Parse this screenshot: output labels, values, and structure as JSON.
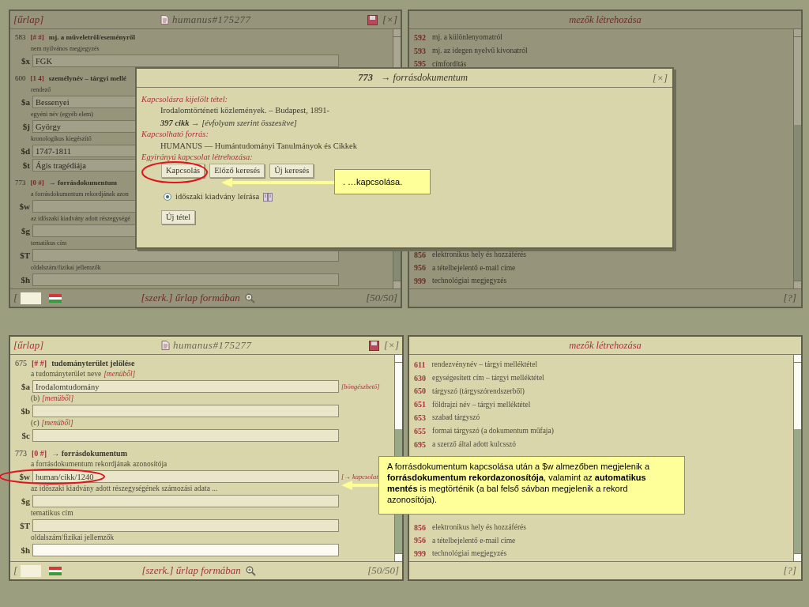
{
  "top_form_window": {
    "dimmed": true,
    "header_left": "[űrlap]",
    "title": "humanus#175277",
    "header_right": "[×]",
    "tags": [
      {
        "tag": "583",
        "indicators": "[# #]",
        "name": "mj. a műveletről/eseményről",
        "subfields": [
          {
            "hint": "nem nyilvános megjegyzés",
            "code": "$x",
            "value": "FGK"
          }
        ]
      },
      {
        "tag": "600",
        "indicators": "[1 4]",
        "name": "személynév – tárgyi mellé",
        "subfields": [
          {
            "hint": "rendező",
            "code": "$a",
            "value": "Bessenyei"
          },
          {
            "hint": "egyéni név (egyéb elem)",
            "code": "$j",
            "value": "György"
          },
          {
            "hint": "kronologikus kiegészítő",
            "code": "$d",
            "value": "1747-1811"
          },
          {
            "code": "$t",
            "value": "Ágis tragédiája"
          }
        ]
      },
      {
        "tag": "773",
        "indicators": "[0 #]",
        "name": "→ forrásdokumentum",
        "subfields": [
          {
            "hint": "a forrásdokumentum rekordjának azon",
            "code": "$w"
          },
          {
            "hint": "az időszaki kiadvány adott részegységé",
            "code": "$g"
          },
          {
            "hint": "tematikus cím",
            "code": "$T"
          },
          {
            "hint": "oldalszám/fizikai jellemzők",
            "code": "$h"
          }
        ]
      }
    ],
    "footer_left": "[",
    "footer_center": "[szerk.] űrlap formában",
    "footer_right": "[50/50]"
  },
  "top_fields_window": {
    "dimmed": true,
    "title": "mezők létrehozása",
    "items": [
      {
        "code": "592",
        "label": "mj. a különlenyomatról"
      },
      {
        "code": "593",
        "label": "mj. az idegen nyelvű kivonatról"
      },
      {
        "code": "595",
        "label": "címfordítás"
      }
    ],
    "items_below": [
      {
        "code": "856",
        "label": "elektronikus hely és hozzáférés"
      },
      {
        "code": "956",
        "label": "a tételbejelentő e-mail címe"
      },
      {
        "code": "999",
        "label": "technológiai megjegyzés"
      }
    ],
    "footer_right": "[?]"
  },
  "dialog": {
    "tag": "773",
    "title": "→ forrásdokumentum",
    "close": "[×]",
    "sections": [
      {
        "label": "Kapcsolásra kijelölt tétel:",
        "lines": [
          "Irodalomtörténeti közlemények. – Budapest, 1891-",
          "**397 cikk** → [évfolyam szerint összesítve]"
        ]
      },
      {
        "label": "Kapcsolható forrás:",
        "lines": [
          "HUMANUS — Humántudományi Tanulmányok és Cikkek"
        ]
      },
      {
        "label": "Egyirányú kapcsolat létrehozása:"
      }
    ],
    "buttons": [
      "Kapcsolás",
      "Előző keresés",
      "Új keresés"
    ],
    "options": [
      {
        "label": "időszaki kiadvány leírása",
        "selected": true
      }
    ],
    "new_button": "Új tétel"
  },
  "callout_top": {
    "text": ". …kapcsolása."
  },
  "bottom_form_window": {
    "dimmed": false,
    "header_left": "[űrlap]",
    "title": "humanus#175277",
    "header_right": "[×]",
    "tags": [
      {
        "tag": "675",
        "indicators": "[# #]",
        "name": "tudományterület jelölése",
        "subfields": [
          {
            "hint": "a tudományterület neve",
            "hint_note": "[menüből]",
            "code": "$a",
            "value": "Irodalomtudomány",
            "side_note": "[böngészhető]"
          },
          {
            "hint": "(b)",
            "hint_note": "[menüből]",
            "code": "$b"
          },
          {
            "hint": "(c)",
            "hint_note": "[menüből]",
            "code": "$c"
          }
        ]
      },
      {
        "tag": "773",
        "indicators": "[0 #]",
        "name": "→ forrásdokumentum",
        "subfields": [
          {
            "hint": "a forrásdokumentum rekordjának azonosítója",
            "code": "$w",
            "value": "human/cikk/1240",
            "side_note": "[→ kapcsolat"
          },
          {
            "hint": "az időszaki kiadvány adott részegységének számozási adata ...",
            "code": "$g"
          },
          {
            "hint": "tematikus cím",
            "code": "$T"
          },
          {
            "hint": "oldalszám/fizikai jellemzők",
            "code": "$h",
            "focused": true
          }
        ]
      }
    ],
    "footer_left": "[",
    "footer_center": "[szerk.] űrlap formában",
    "footer_right": "[50/50]"
  },
  "bottom_fields_window": {
    "dimmed": false,
    "title": "mezők létrehozása",
    "items": [
      {
        "code": "611",
        "label": "rendezvénynév – tárgyi melléktétel"
      },
      {
        "code": "630",
        "label": "egységesített cím – tárgyi melléktétel"
      },
      {
        "code": "650",
        "label": "tárgyszó (tárgyszórendszerből)"
      },
      {
        "code": "651",
        "label": "földrajzi név – tárgyi melléktétel"
      },
      {
        "code": "653",
        "label": "szabad tárgyszó"
      },
      {
        "code": "655",
        "label": "formai tárgyszó (a dokumentum műfaja)"
      },
      {
        "code": "695",
        "label": "a szerző által adott kulcsszó"
      }
    ],
    "items_below": [
      {
        "code": "856",
        "label": "elektronikus hely és hozzáférés"
      },
      {
        "code": "956",
        "label": "a tételbejelentő e-mail címe"
      },
      {
        "code": "999",
        "label": "technológiai megjegyzés"
      }
    ],
    "footer_right": "[?]"
  },
  "callout_bottom": {
    "text": "A forrásdokumentum kapcsolása után a $w almezőben megjelenik a **forrásdokumentum rekordazonosítója**, valamint  az **automatikus mentés** is megtörténik (a bal felső sávban megjelenik a rekord azonosítója)."
  }
}
